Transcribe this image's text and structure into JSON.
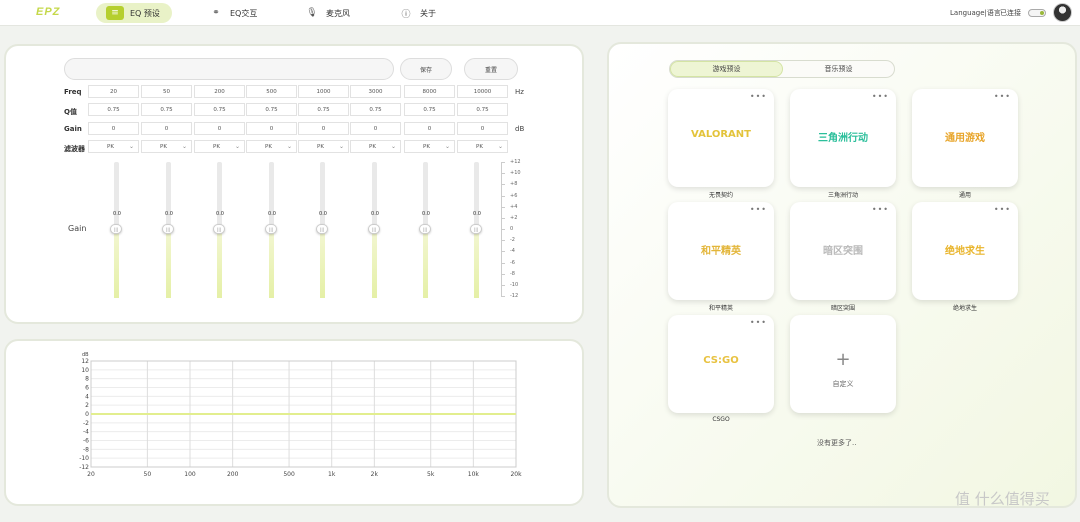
{
  "nav": {
    "logo": "EPZ",
    "items": [
      {
        "label": "EQ 预设",
        "icon": "eq-preset-icon"
      },
      {
        "label": "EQ交互",
        "icon": "eq-interact-icon"
      },
      {
        "label": "麦克风",
        "icon": "microphone-icon"
      },
      {
        "label": "关于",
        "icon": "info-icon"
      }
    ],
    "language": "Language|语言",
    "status": "已连接"
  },
  "eq": {
    "save_label": "保存",
    "reset_label": "重置",
    "rows": {
      "freq": {
        "label": "Freq",
        "unit": "Hz",
        "values": [
          "20",
          "50",
          "200",
          "500",
          "1000",
          "3000",
          "8000",
          "10000"
        ]
      },
      "q": {
        "label": "Q值",
        "unit": "",
        "values": [
          "0.75",
          "0.75",
          "0.75",
          "0.75",
          "0.75",
          "0.75",
          "0.75",
          "0.75"
        ]
      },
      "gain": {
        "label": "Gain",
        "unit": "dB",
        "values": [
          "0",
          "0",
          "0",
          "0",
          "0",
          "0",
          "0",
          "0"
        ]
      },
      "filter": {
        "label": "滤波器",
        "unit": "",
        "values": [
          "PK",
          "PK",
          "PK",
          "PK",
          "PK",
          "PK",
          "PK",
          "PK"
        ]
      }
    },
    "gain_label": "Gain",
    "slider_values": [
      "0.0",
      "0.0",
      "0.0",
      "0.0",
      "0.0",
      "0.0",
      "0.0",
      "0.0"
    ],
    "scale": [
      "+12",
      "+10",
      "+8",
      "+6",
      "+4",
      "+2",
      "0",
      "-2",
      "-4",
      "-6",
      "-8",
      "-10",
      "-12"
    ]
  },
  "chart_data": {
    "type": "line",
    "ylabel": "dB",
    "ylim": [
      -12,
      12
    ],
    "y_ticks": [
      "12",
      "10",
      "8",
      "6",
      "4",
      "2",
      "0",
      "-2",
      "-4",
      "-6",
      "-8",
      "-10",
      "-12"
    ],
    "x_ticks": [
      "20",
      "50",
      "100",
      "200",
      "500",
      "1k",
      "2k",
      "5k",
      "10k",
      "20k"
    ],
    "x_tick_values": [
      20,
      50,
      100,
      200,
      500,
      1000,
      2000,
      5000,
      10000,
      20000
    ],
    "x_scale": "log",
    "xlim": [
      20,
      20000
    ],
    "series": [
      {
        "x": [
          20,
          20000
        ],
        "values": [
          0,
          0
        ]
      }
    ]
  },
  "presets": {
    "tabs": [
      "游戏预设",
      "音乐预设"
    ],
    "cards": [
      {
        "logo": "VALORANT",
        "label": "无畏契约",
        "color": "#e3c33a"
      },
      {
        "logo": "三角洲行动",
        "label": "三角洲行动",
        "color": "#2bbf9b"
      },
      {
        "logo": "通用游戏",
        "label": "通用",
        "color": "#e8a52a"
      },
      {
        "logo": "和平精英",
        "label": "和平精英",
        "color": "#e3b63a"
      },
      {
        "logo": "暗区突围",
        "label": "暗区突围",
        "color": "#b9b9b9"
      },
      {
        "logo": "绝地求生",
        "label": "绝地求生",
        "color": "#e9b52c"
      },
      {
        "logo": "CS:GO",
        "label": "CSGO",
        "color": "#e8c240"
      }
    ],
    "custom_label": "自定义",
    "more_text": "没有更多了..",
    "dots": "•••"
  },
  "watermark": "值 什么值得买"
}
